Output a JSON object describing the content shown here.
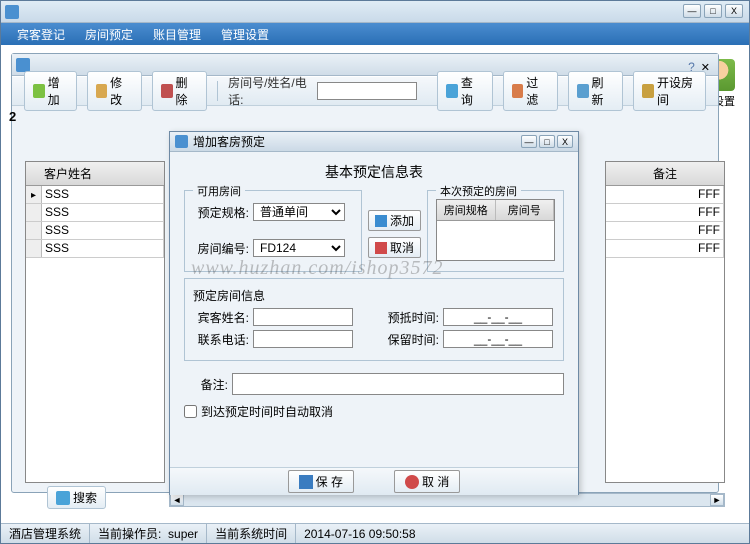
{
  "menu": {
    "guest_checkin": "宾客登记",
    "room_reserve": "房间预定",
    "account_mgmt": "账目管理",
    "mgmt_settings": "管理设置"
  },
  "toolbar": {
    "add": "增加",
    "edit": "修 改",
    "delete": "删 除",
    "room_label": "房间号/姓名/电话:",
    "query": "查 询",
    "filter": "过 滤",
    "refresh": "刷 新",
    "open_room": "开设房间"
  },
  "side_icon_label": "间设置",
  "body_index": "2",
  "grid": {
    "header": "客户姓名",
    "rows": [
      "SSS",
      "SSS",
      "SSS",
      "SSS"
    ],
    "right_header": "备注",
    "right_rows": [
      "FFF",
      "FFF",
      "FFF",
      "FFF"
    ]
  },
  "search_btn": "搜索",
  "dialog": {
    "title": "增加客房预定",
    "form_title": "基本预定信息表",
    "avail_room": "可用房间",
    "booked_room": "本次预定的房间",
    "spec_label": "预定规格:",
    "spec_value": "普通单间",
    "room_no_label": "房间编号:",
    "room_no_value": "FD124",
    "add_btn": "添加",
    "cancel_btn": "取消",
    "mini_cols": {
      "spec": "房间规格",
      "no": "房间号"
    },
    "booking_info": "预定房间信息",
    "guest_name": "宾客姓名:",
    "contact": "联系电话:",
    "arrive": "预抵时间:",
    "keep": "保留时间:",
    "time_ph": "__-__-__",
    "remark": "备注:",
    "auto_cancel": "到达预定时间时自动取消",
    "save": "保 存",
    "cancel": "取 消"
  },
  "status": {
    "system": "酒店管理系统",
    "operator_label": "当前操作员:",
    "operator": "super",
    "time_label": "当前系统时间",
    "time": "2014-07-16 09:50:58"
  },
  "watermark": "www.huzhan.com/ishop3572"
}
